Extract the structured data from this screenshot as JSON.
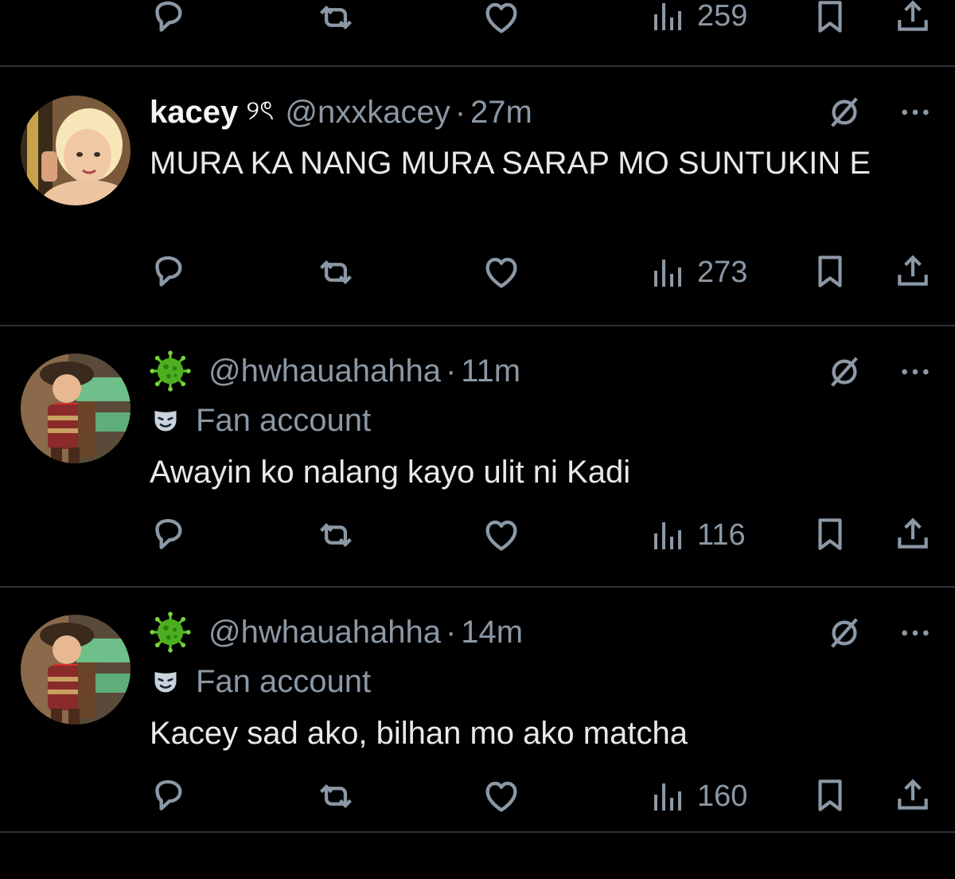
{
  "top_actions": {
    "views": "259"
  },
  "tweets": [
    {
      "name": "kacey",
      "name_glyph": "୨ৎ",
      "handle": "@nxxkacey",
      "separator": "·",
      "time": "27m",
      "text": "MURA KA NANG MURA SARAP MO SUNTUKIN E",
      "views": "273",
      "avatar_colors": [
        "#f3d4b0",
        "#e9c29a",
        "#b8845a"
      ]
    },
    {
      "handle": "@hwhauahahha",
      "separator": "·",
      "time": "11m",
      "label": "Fan account",
      "text": "Awayin ko nalang kayo ulit ni Kadi",
      "views": "116"
    },
    {
      "handle": "@hwhauahahha",
      "separator": "·",
      "time": "14m",
      "label": "Fan account",
      "text": "Kacey sad ako, bilhan mo ako matcha",
      "views": "160"
    }
  ],
  "icons": {
    "reply": "reply-icon",
    "retweet": "retweet-icon",
    "like": "heart-icon",
    "views": "analytics-icon",
    "bookmark": "bookmark-icon",
    "share": "share-icon",
    "grok": "grok-icon",
    "more": "more-icon",
    "fan": "theater-mask-icon",
    "virus": "microbe-icon"
  },
  "colors": {
    "background": "#000000",
    "text": "#e7e9ea",
    "secondary": "#8b98a5",
    "divider": "#2f3336",
    "virus": "#5cbf2a"
  }
}
